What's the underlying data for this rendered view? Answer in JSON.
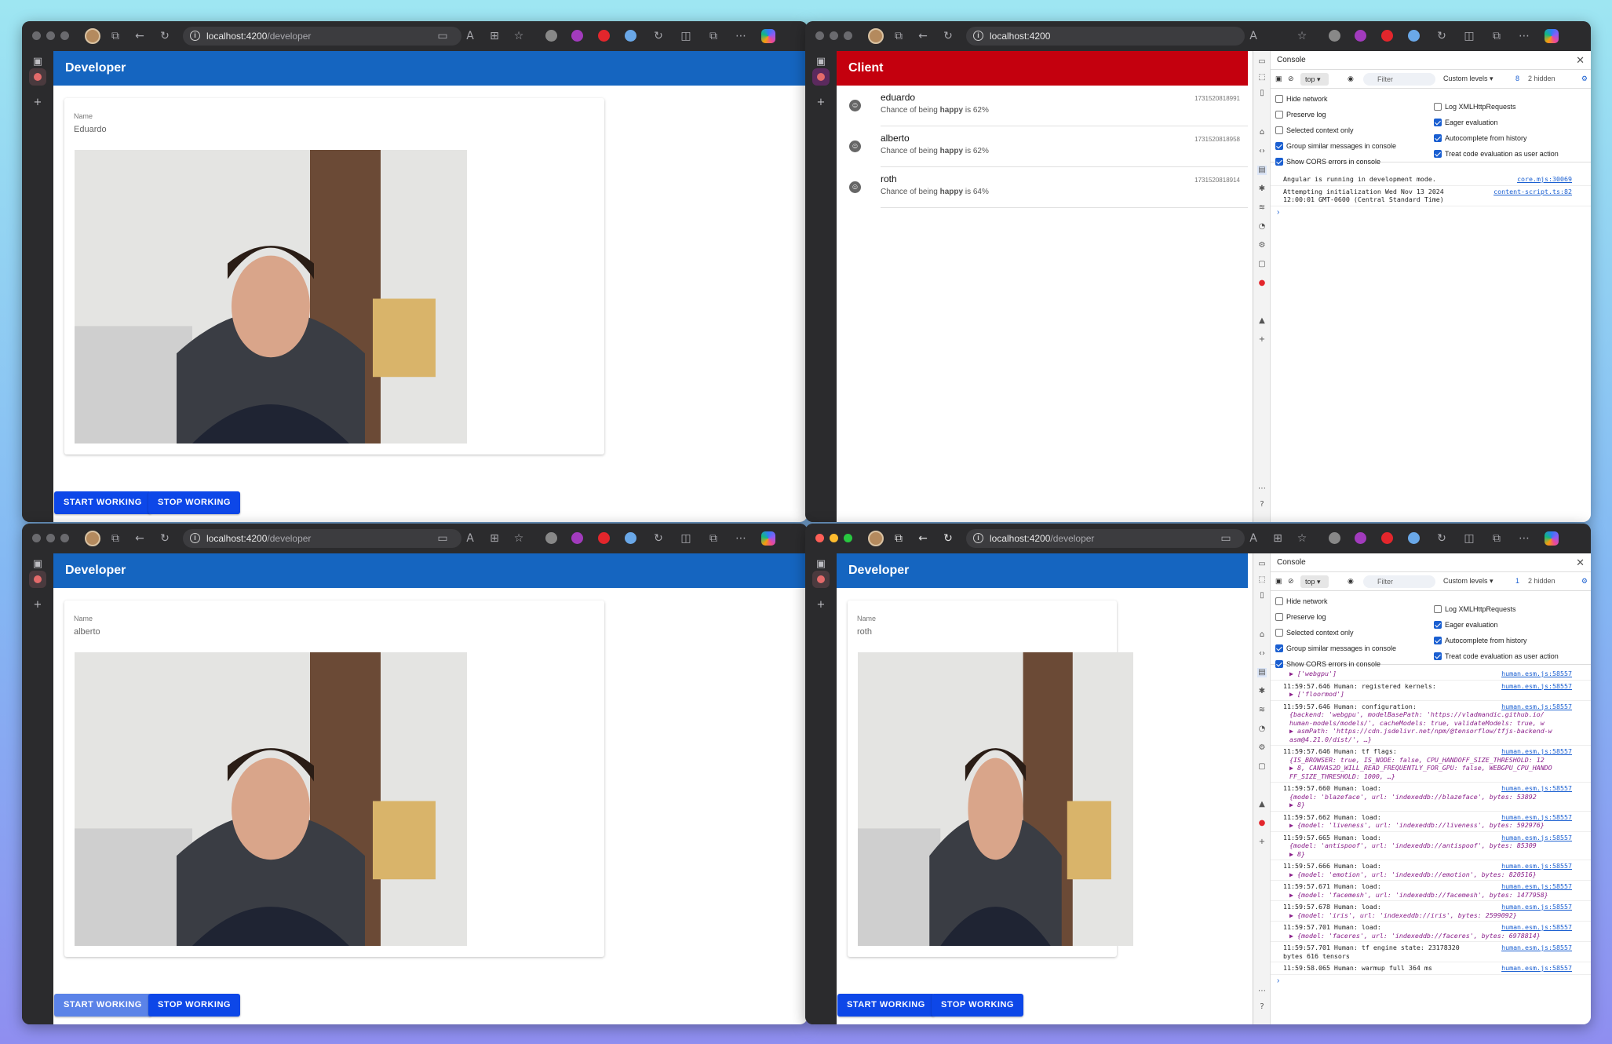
{
  "colors": {
    "developer_bar": "#1565c0",
    "client_bar": "#c4000e",
    "button": "#0d47e8",
    "desktop": "#9ee6f2"
  },
  "windows": [
    {
      "url_host": "localhost:4200",
      "url_path": "/developer",
      "app_title": "Developer",
      "name_label": "Name",
      "name_value": "Eduardo",
      "start_label": "START WORKING",
      "stop_label": "STOP WORKING"
    },
    {
      "url_host": "localhost:4200",
      "url_path": "",
      "app_title": "Client",
      "items": [
        {
          "name": "eduardo",
          "prefix": "Chance of being ",
          "emotion": "happy",
          "suffix": " is 62%",
          "ts": "1731520818991"
        },
        {
          "name": "alberto",
          "prefix": "Chance of being ",
          "emotion": "happy",
          "suffix": " is 62%",
          "ts": "1731520818958"
        },
        {
          "name": "roth",
          "prefix": "Chance of being ",
          "emotion": "happy",
          "suffix": " is 64%",
          "ts": "1731520818914"
        }
      ]
    },
    {
      "url_host": "localhost:4200",
      "url_path": "/developer",
      "app_title": "Developer",
      "name_label": "Name",
      "name_value": "alberto",
      "start_label": "START WORKING",
      "stop_label": "STOP WORKING"
    },
    {
      "url_host": "localhost:4200",
      "url_path": "/developer",
      "app_title": "Developer",
      "name_label": "Name",
      "name_value": "roth",
      "start_label": "START WORKING",
      "stop_label": "STOP WORKING"
    }
  ],
  "devtools": [
    {
      "title": "Console",
      "context": "top",
      "filter": "Filter",
      "levels": "Custom levels",
      "count": "8",
      "hidden": "2 hidden",
      "left_options": [
        {
          "label": "Hide network",
          "checked": false
        },
        {
          "label": "Preserve log",
          "checked": false
        },
        {
          "label": "Selected context only",
          "checked": false
        },
        {
          "label": "Group similar messages in console",
          "checked": true
        },
        {
          "label": "Show CORS errors in console",
          "checked": true
        }
      ],
      "right_options": [
        {
          "label": "Log XMLHttpRequests",
          "checked": false
        },
        {
          "label": "Eager evaluation",
          "checked": true
        },
        {
          "label": "Autocomplete from history",
          "checked": true
        },
        {
          "label": "Treat code evaluation as user action",
          "checked": true
        }
      ],
      "logs": [
        {
          "text": "Angular is running in development mode.",
          "src": "core.mjs:30069"
        },
        {
          "text": "Attempting initialization Wed Nov 13 2024\n12:00:01 GMT-0600 (Central Standard Time)",
          "src": "content-script.ts:82"
        }
      ]
    },
    {
      "title": "Console",
      "context": "top",
      "filter": "Filter",
      "levels": "Custom levels",
      "count": "1",
      "hidden": "2 hidden",
      "left_options": [
        {
          "label": "Hide network",
          "checked": false
        },
        {
          "label": "Preserve log",
          "checked": false
        },
        {
          "label": "Selected context only",
          "checked": false
        },
        {
          "label": "Group similar messages in console",
          "checked": true
        },
        {
          "label": "Show CORS errors in console",
          "checked": true
        }
      ],
      "right_options": [
        {
          "label": "Log XMLHttpRequests",
          "checked": false
        },
        {
          "label": "Eager evaluation",
          "checked": true
        },
        {
          "label": "Autocomplete from history",
          "checked": true
        },
        {
          "label": "Treat code evaluation as user action",
          "checked": true
        }
      ],
      "logs": [
        {
          "text": "",
          "obj": "▶ ['webgpu']",
          "src": "human.esm.js:58557"
        },
        {
          "text": "11:59:57.646 Human: registered kernels:",
          "obj": "▶ ['floormod']",
          "src": "human.esm.js:58557"
        },
        {
          "text": "11:59:57.646 Human: configuration:",
          "obj": "{backend: 'webgpu', modelBasePath: 'https://vladmandic.github.io/\nhuman-models/models/', cacheModels: true, validateModels: true, w\n▶ asmPath: 'https://cdn.jsdelivr.net/npm/@tensorflow/tfjs-backend-w\nasm@4.21.0/dist/', …}",
          "src": "human.esm.js:58557"
        },
        {
          "text": "11:59:57.646 Human: tf flags:",
          "obj": "{IS_BROWSER: true, IS_NODE: false, CPU_HANDOFF_SIZE_THRESHOLD: 12\n▶ 8, CANVAS2D_WILL_READ_FREQUENTLY_FOR_GPU: false, WEBGPU_CPU_HANDO\nFF_SIZE_THRESHOLD: 1000, …}",
          "src": "human.esm.js:58557"
        },
        {
          "text": "11:59:57.660 Human: load:",
          "obj": "{model: 'blazeface', url: 'indexeddb://blazeface', bytes: 53892\n▶ 8}",
          "src": "human.esm.js:58557"
        },
        {
          "text": "11:59:57.662 Human: load:",
          "obj": "▶ {model: 'liveness', url: 'indexeddb://liveness', bytes: 592976}",
          "src": "human.esm.js:58557"
        },
        {
          "text": "11:59:57.665 Human: load:",
          "obj": "{model: 'antispoof', url: 'indexeddb://antispoof', bytes: 85309\n▶ 8}",
          "src": "human.esm.js:58557"
        },
        {
          "text": "11:59:57.666 Human: load:",
          "obj": "▶ {model: 'emotion', url: 'indexeddb://emotion', bytes: 820516}",
          "src": "human.esm.js:58557"
        },
        {
          "text": "11:59:57.671 Human: load:",
          "obj": "▶ {model: 'facemesh', url: 'indexeddb://facemesh', bytes: 1477958}",
          "src": "human.esm.js:58557"
        },
        {
          "text": "11:59:57.678 Human: load:",
          "obj": "▶ {model: 'iris', url: 'indexeddb://iris', bytes: 2599092}",
          "src": "human.esm.js:58557"
        },
        {
          "text": "11:59:57.701 Human: load:",
          "obj": "▶ {model: 'faceres', url: 'indexeddb://faceres', bytes: 6978814}",
          "src": "human.esm.js:58557"
        },
        {
          "text": "11:59:57.701 Human: tf engine state: 23178320\nbytes 616 tensors",
          "src": "human.esm.js:58557"
        },
        {
          "text": "11:59:58.065 Human: warmup full 364 ms",
          "src": "human.esm.js:58557"
        }
      ]
    }
  ]
}
